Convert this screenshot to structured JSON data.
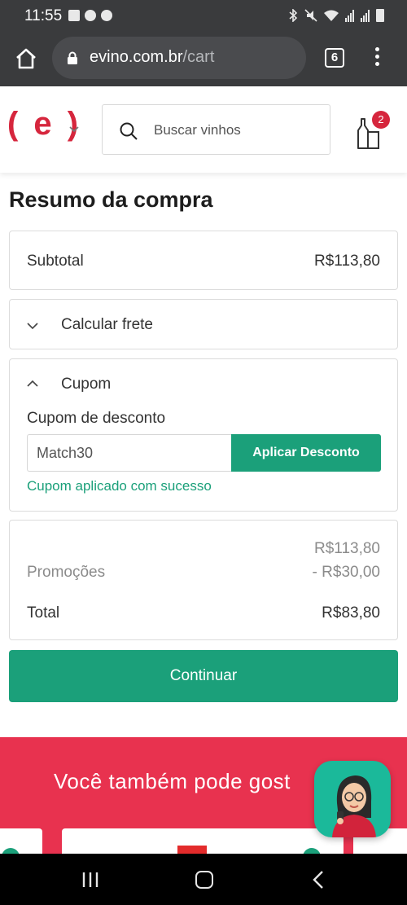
{
  "status_bar": {
    "time": "11:55"
  },
  "browser": {
    "domain": "evino.com.br",
    "path": "/cart",
    "tab_count": "6"
  },
  "header": {
    "logo_text": "( e )",
    "search_placeholder": "Buscar vinhos",
    "cart_count": "2"
  },
  "summary": {
    "title": "Resumo da compra",
    "subtotal_label": "Subtotal",
    "subtotal_value": "R$113,80",
    "shipping_label": "Calcular frete",
    "coupon_section_label": "Cupom",
    "coupon_field_label": "Cupom de desconto",
    "coupon_value": "Match30",
    "apply_button": "Aplicar Desconto",
    "coupon_success": "Cupom aplicado com sucesso",
    "totals_subtotal": "R$113,80",
    "promo_label": "Promoções",
    "promo_value": "- R$30,00",
    "total_label": "Total",
    "total_value": "R$83,80",
    "continue_button": "Continuar"
  },
  "recommendations": {
    "title": "Você também pode gost"
  },
  "colors": {
    "brand_red": "#d6263d",
    "accent_green": "#1ba07a",
    "reco_bg": "#e8324f"
  },
  "icons": [
    "home-icon",
    "lock-icon",
    "tabs-icon",
    "menu-icon",
    "chevron-down-icon",
    "search-icon",
    "cart-icon",
    "chevron-up-icon",
    "chat-assistant-icon",
    "recents-icon",
    "nav-home-icon",
    "back-icon"
  ]
}
